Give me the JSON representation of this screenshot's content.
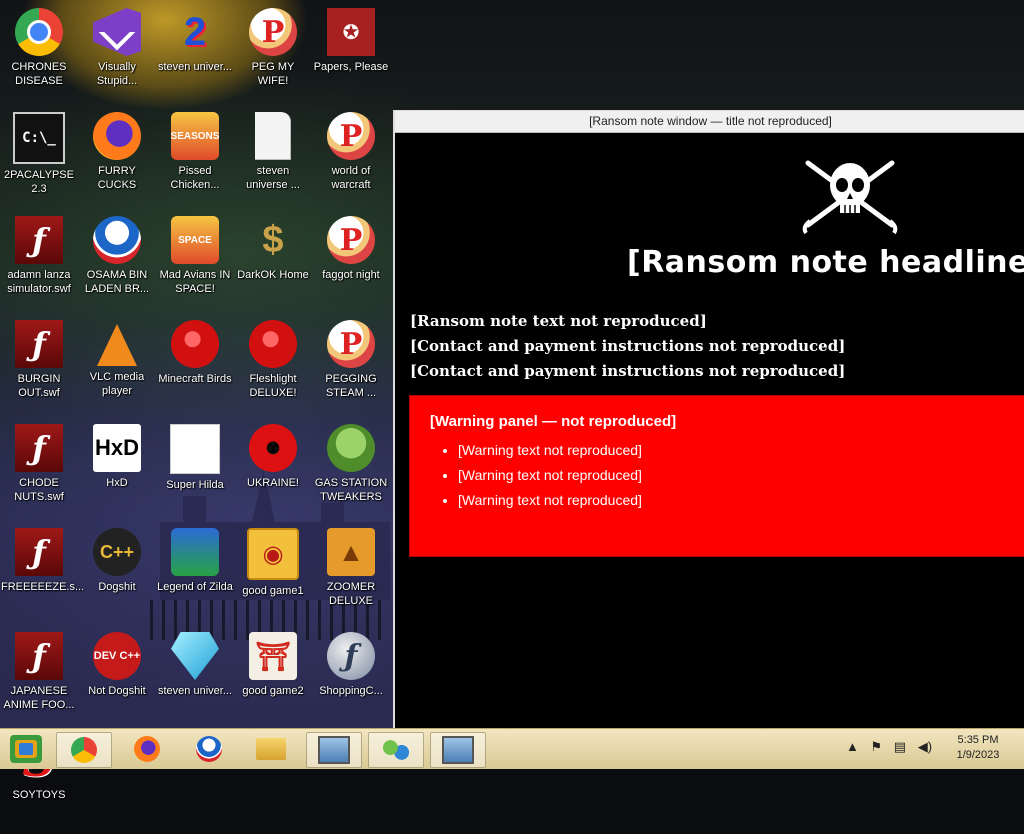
{
  "desktop": {
    "icons": [
      {
        "label": "CHRONES DISEASE",
        "glyph": "",
        "icon": "chrome-icon"
      },
      {
        "label": "Visually Stupid...",
        "glyph": "",
        "icon": "visual-studio-icon"
      },
      {
        "label": "steven univer...",
        "glyph": "2",
        "icon": "steven-universe-icon"
      },
      {
        "label": "PEG MY WIFE!",
        "glyph": "P",
        "icon": "peggle-icon"
      },
      {
        "label": "Papers, Please",
        "glyph": "✪",
        "icon": "papers-please-icon"
      },
      {
        "label": "2PACALYPSE 2.3",
        "glyph": "C:\\_",
        "icon": "command-prompt-icon"
      },
      {
        "label": "FURRY CUCKS",
        "glyph": "",
        "icon": "firefox-icon"
      },
      {
        "label": "Pissed Chicken...",
        "glyph": "SEASONS",
        "icon": "angry-birds-seasons-icon"
      },
      {
        "label": "steven universe ...",
        "glyph": "",
        "icon": "document-icon"
      },
      {
        "label": "world of warcraft",
        "glyph": "P",
        "icon": "peggle-icon"
      },
      {
        "label": "adamn lanza simulator.swf",
        "glyph": "ƒ",
        "icon": "flash-file-icon"
      },
      {
        "label": "OSAMA BIN LADEN BR...",
        "glyph": "",
        "icon": "obama-logo-icon"
      },
      {
        "label": "Mad Avians IN SPACE!",
        "glyph": "SPACE",
        "icon": "angry-birds-space-icon"
      },
      {
        "label": "DarkOK Home",
        "glyph": "$",
        "icon": "money-bag-icon"
      },
      {
        "label": "faggot night",
        "glyph": "P",
        "icon": "peggle-nights-icon"
      },
      {
        "label": "BURGIN OUT.swf",
        "glyph": "ƒ",
        "icon": "flash-file-icon"
      },
      {
        "label": "VLC media player",
        "glyph": "",
        "icon": "vlc-cone-icon"
      },
      {
        "label": "Minecraft Birds",
        "glyph": "",
        "icon": "angry-birds-icon"
      },
      {
        "label": "Fleshlight DELUXE!",
        "glyph": "",
        "icon": "red-creature-icon"
      },
      {
        "label": "PEGGING STEAM ...",
        "glyph": "P",
        "icon": "peggle-icon"
      },
      {
        "label": "CHODE NUTS.swf",
        "glyph": "ƒ",
        "icon": "flash-file-icon"
      },
      {
        "label": "HxD",
        "glyph": "HxD",
        "icon": "hxd-icon"
      },
      {
        "label": "Super Hilda",
        "glyph": "",
        "icon": "pixel-dog-icon"
      },
      {
        "label": "UKRAINE!",
        "glyph": "☢",
        "icon": "radiation-icon"
      },
      {
        "label": "GAS STATION TWEAKERS",
        "glyph": "",
        "icon": "plants-vs-zombies-icon"
      },
      {
        "label": "FREEEEEZE.s...",
        "glyph": "ƒ",
        "icon": "flash-file-icon"
      },
      {
        "label": "Dogshit",
        "glyph": "C++",
        "icon": "cpp-icon"
      },
      {
        "label": "Legend of Zilda",
        "glyph": "",
        "icon": "pixel-hero-icon"
      },
      {
        "label": "good game1",
        "glyph": "◉",
        "icon": "mahjong-tile-icon"
      },
      {
        "label": "ZOOMER DELUXE",
        "glyph": "▲",
        "icon": "zuma-icon"
      },
      {
        "label": "JAPANESE ANIME FOO...",
        "glyph": "ƒ",
        "icon": "flash-file-icon"
      },
      {
        "label": "Not Dogshit",
        "glyph": "DEV C++",
        "icon": "dev-cpp-icon"
      },
      {
        "label": "steven univer...",
        "glyph": "",
        "icon": "diamond-icon"
      },
      {
        "label": "good game2",
        "glyph": "⛩",
        "icon": "torii-gate-icon"
      },
      {
        "label": "ShoppingC...",
        "glyph": "ƒ",
        "icon": "flash-player-icon"
      },
      {
        "label": "SOYTOYS",
        "glyph": "S",
        "icon": "red-s-icon"
      }
    ]
  },
  "window": {
    "title": "[Ransom note window — title not reproduced]",
    "banner": "[Ransom note headline not reproduced]",
    "lines": [
      "[Ransom note text not reproduced]",
      "[Contact and payment instructions not reproduced]",
      "[Contact and payment instructions not reproduced]"
    ],
    "attention_title": "[Warning panel — not reproduced]",
    "attention_items": [
      "[Warning text not reproduced]",
      "[Warning text not reproduced]",
      "[Warning text not reproduced]"
    ]
  },
  "taskbar": {
    "clock_time": "5:35 PM",
    "clock_date": "1/9/2023",
    "tray": {
      "chevron": "▲",
      "flag": "⚑",
      "network": "▤",
      "volume": "◀)"
    }
  }
}
